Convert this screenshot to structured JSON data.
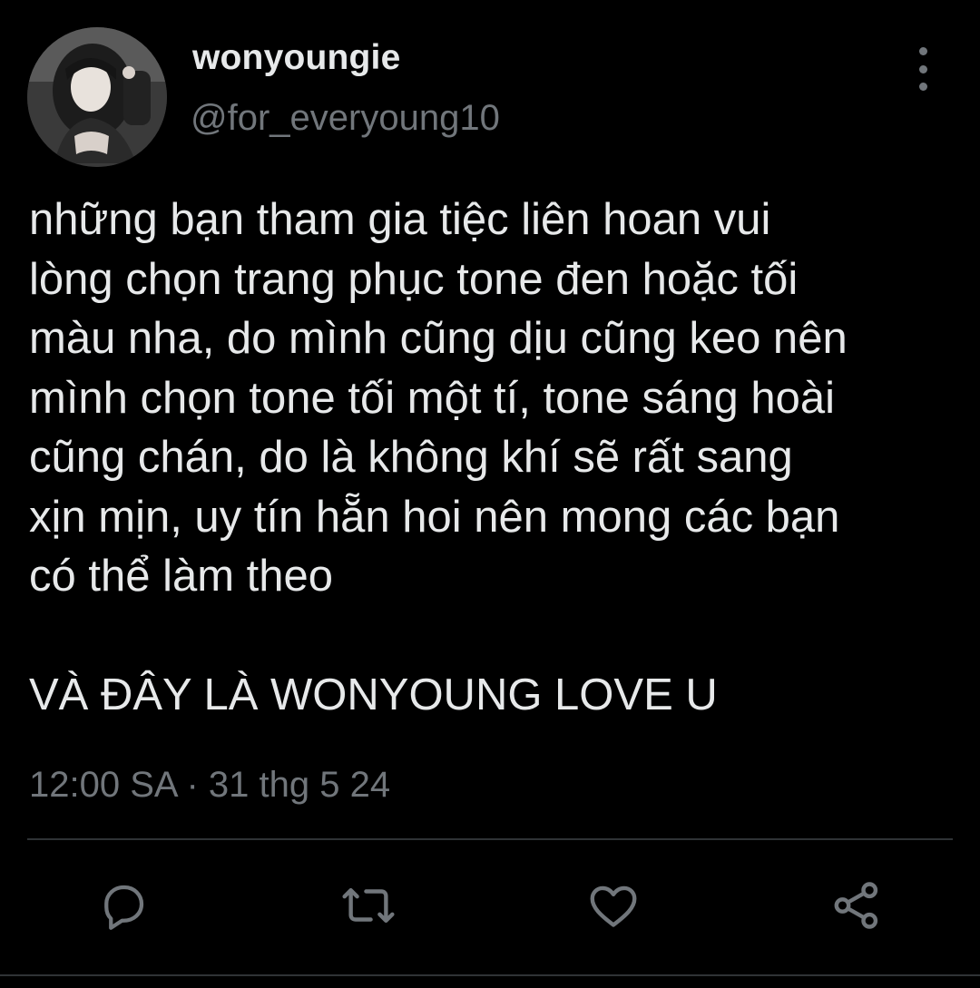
{
  "tweet": {
    "display_name": "wonyoungie",
    "handle": "@for_everyoung10",
    "text": "những bạn tham gia tiệc liên hoan vui\nlòng chọn trang phục tone đen hoặc tối\nmàu nha, do mình cũng dịu cũng keo nên\nmình chọn tone tối một tí, tone sáng hoài\ncũng chán, do là không khí sẽ rất sang\nxịn mịn, uy tín hẵn hoi nên mong các bạn\ncó thể làm theo\n\nVÀ ĐÂY LÀ WONYOUNG LOVE U",
    "timestamp": "12:00 SA · 31 thg 5 24"
  },
  "icons": {
    "more": "more-vertical-icon",
    "reply": "reply-bubble-icon",
    "retweet": "retweet-icon",
    "like": "heart-icon",
    "share": "share-icon"
  },
  "colors": {
    "background": "#000000",
    "primary_text": "#e7e9ea",
    "secondary_text": "#71767b",
    "divider": "#2f3336"
  }
}
